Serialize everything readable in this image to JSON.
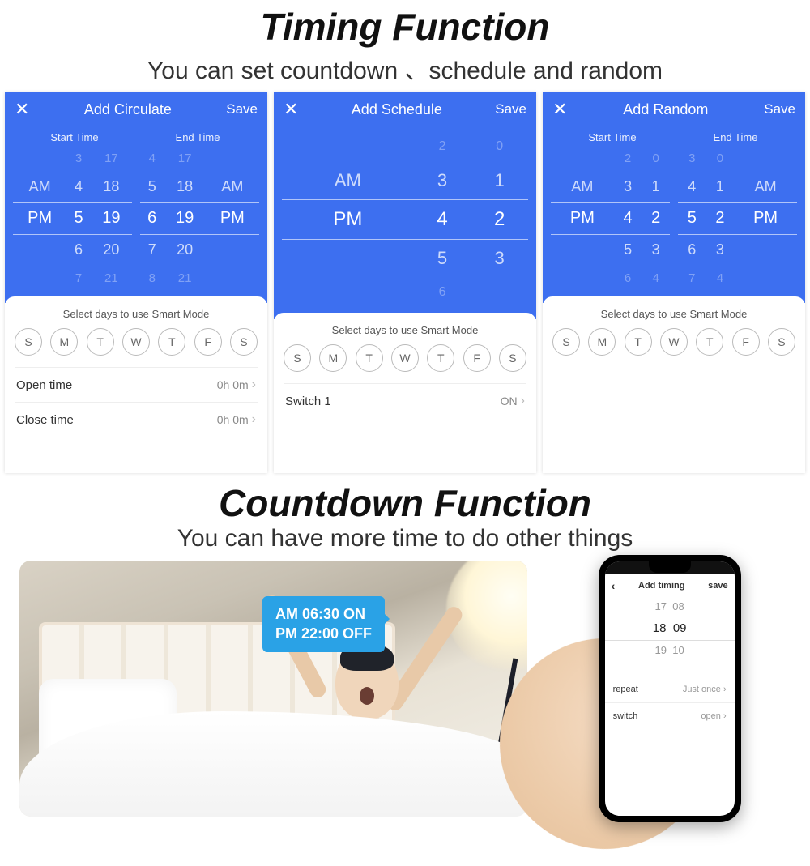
{
  "section1": {
    "title": "Timing Function",
    "subtitle": "You can set countdown 、schedule and random"
  },
  "shared": {
    "save": "Save",
    "close": "✕",
    "start_label": "Start Time",
    "end_label": "End Time",
    "days_caption": "Select days to use Smart Mode",
    "days": [
      "S",
      "M",
      "T",
      "W",
      "T",
      "F",
      "S"
    ],
    "chev": "›"
  },
  "card_circulate": {
    "title": "Add Circulate",
    "start_rows": [
      {
        "a": "",
        "b": "3",
        "c": "17"
      },
      {
        "a": "AM",
        "b": "4",
        "c": "18"
      },
      {
        "a": "PM",
        "b": "5",
        "c": "19"
      },
      {
        "a": "",
        "b": "6",
        "c": "20"
      },
      {
        "a": "",
        "b": "7",
        "c": "21"
      }
    ],
    "end_rows": [
      {
        "a": "4",
        "b": "17",
        "c": ""
      },
      {
        "a": "5",
        "b": "18",
        "c": "AM"
      },
      {
        "a": "6",
        "b": "19",
        "c": "PM"
      },
      {
        "a": "7",
        "b": "20",
        "c": ""
      },
      {
        "a": "8",
        "b": "21",
        "c": ""
      }
    ],
    "open_label": "Open time",
    "open_value": "0h 0m",
    "close_label": "Close time",
    "close_value": "0h 0m"
  },
  "card_schedule": {
    "title": "Add Schedule",
    "rows": [
      {
        "a": "",
        "b": "2",
        "c": "0"
      },
      {
        "a": "AM",
        "b": "3",
        "c": "1"
      },
      {
        "a": "PM",
        "b": "4",
        "c": "2"
      },
      {
        "a": "",
        "b": "5",
        "c": "3"
      },
      {
        "a": "",
        "b": "6",
        "c": ""
      }
    ],
    "switch_label": "Switch 1",
    "switch_value": "ON"
  },
  "card_random": {
    "title": "Add Random",
    "start_rows": [
      {
        "a": "",
        "b": "2",
        "c": "0"
      },
      {
        "a": "AM",
        "b": "3",
        "c": "1"
      },
      {
        "a": "PM",
        "b": "4",
        "c": "2"
      },
      {
        "a": "",
        "b": "5",
        "c": "3"
      },
      {
        "a": "",
        "b": "6",
        "c": "4"
      }
    ],
    "end_rows": [
      {
        "a": "3",
        "b": "0",
        "c": ""
      },
      {
        "a": "4",
        "b": "1",
        "c": "AM"
      },
      {
        "a": "5",
        "b": "2",
        "c": "PM"
      },
      {
        "a": "6",
        "b": "3",
        "c": ""
      },
      {
        "a": "7",
        "b": "4",
        "c": ""
      }
    ]
  },
  "section2": {
    "title": "Countdown Function",
    "subtitle": "You can have more time to do other things"
  },
  "bubble": {
    "line1": "AM 06:30 ON",
    "line2": "PM 22:00 OFF"
  },
  "phone": {
    "title": "Add timing",
    "save": "save",
    "rows": [
      {
        "a": "17",
        "b": "08"
      },
      {
        "a": "18",
        "b": "09"
      },
      {
        "a": "19",
        "b": "10"
      }
    ],
    "repeat_label": "repeat",
    "repeat_value": "Just once",
    "switch_label": "switch",
    "switch_value": "open"
  }
}
